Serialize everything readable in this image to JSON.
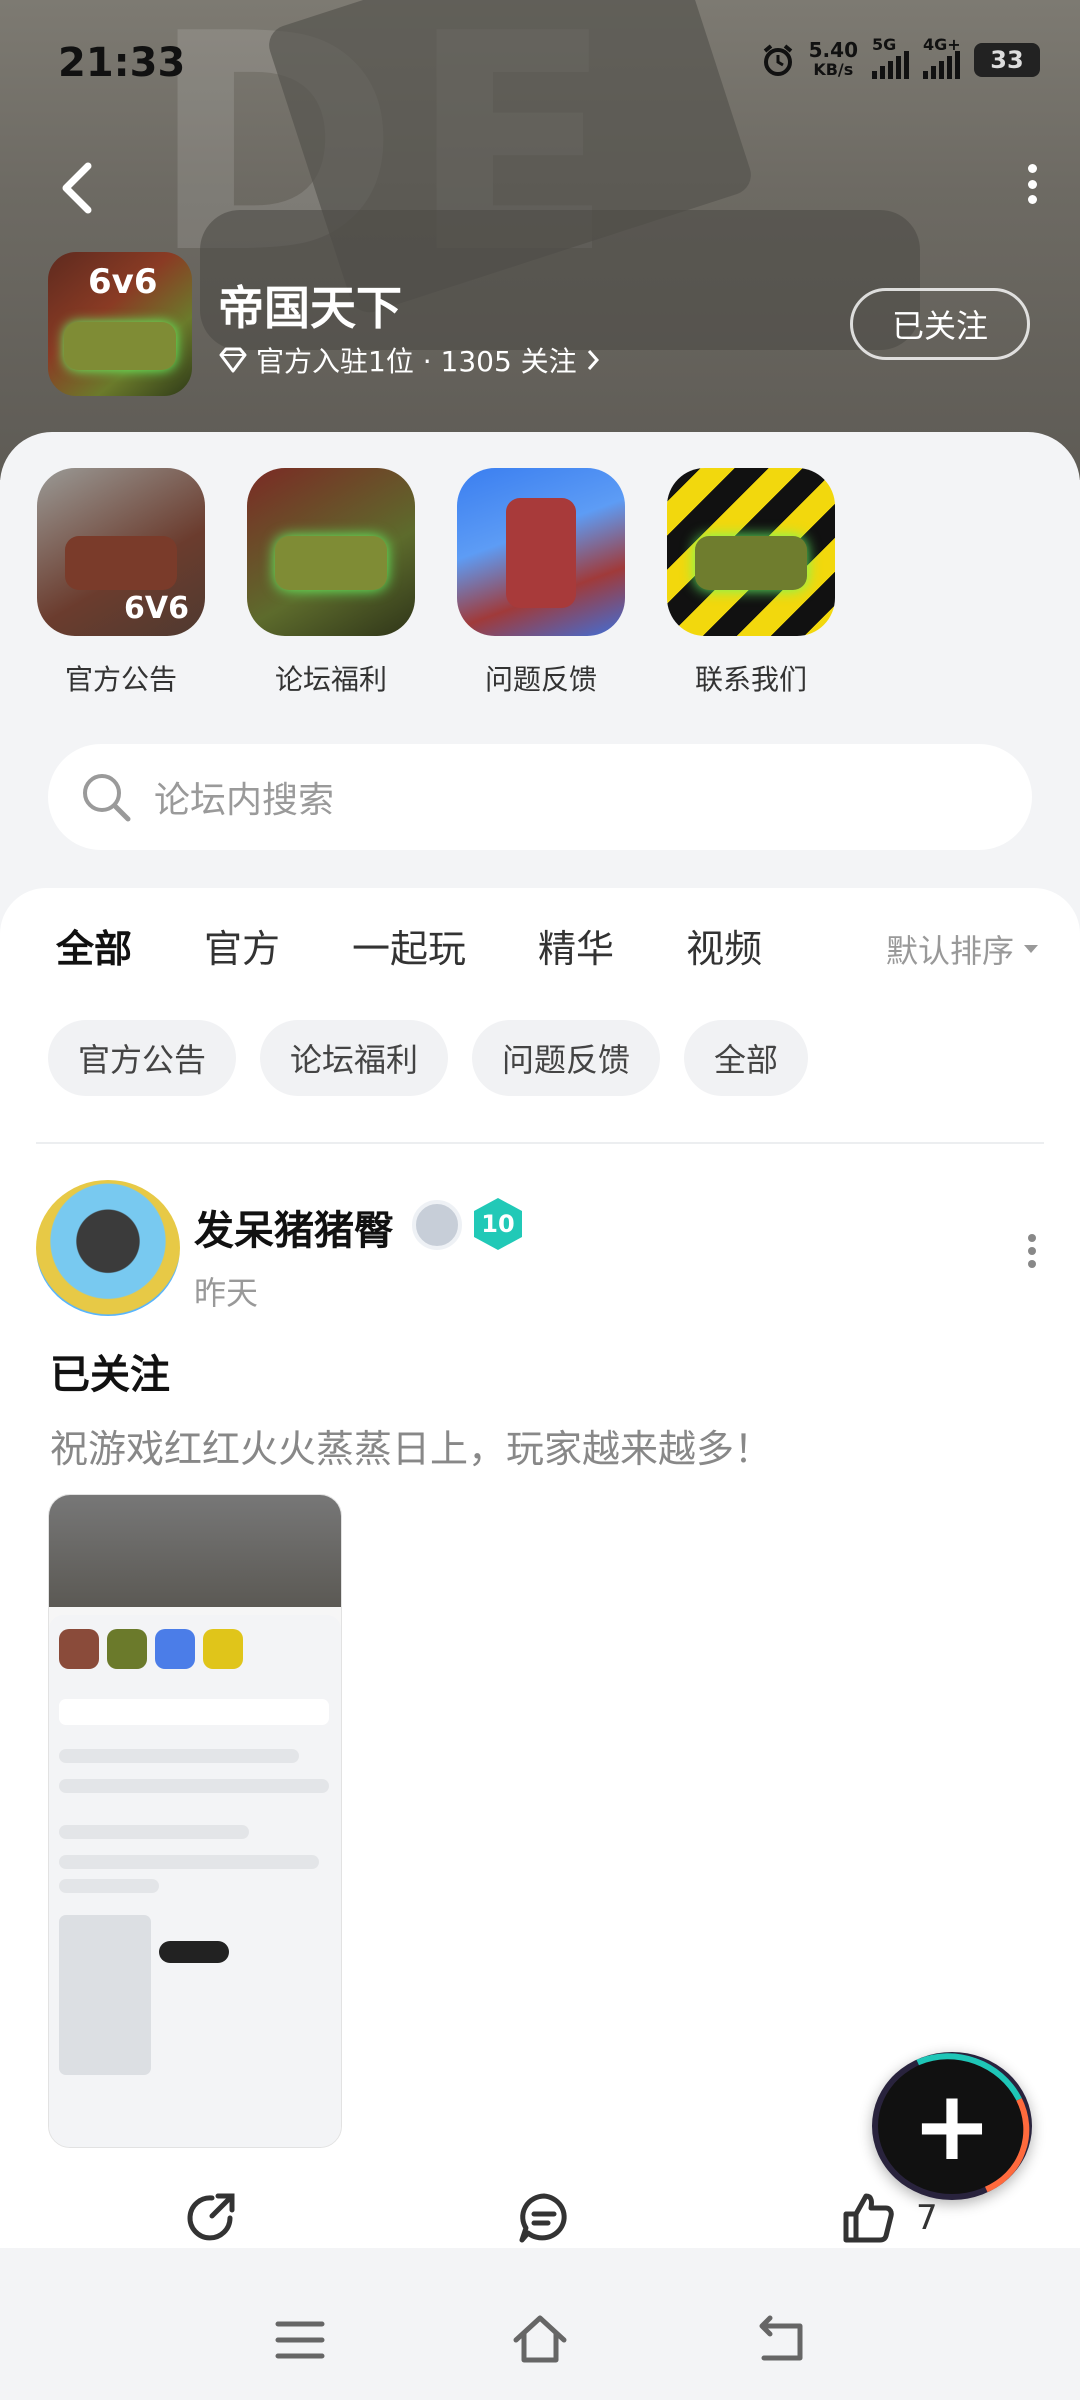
{
  "status_bar": {
    "time": "21:33",
    "speed_value": "5.40",
    "speed_unit": "KB/s",
    "net1": "5G",
    "net2": "4G+",
    "battery": "33"
  },
  "header": {
    "app_name": "帝国天下",
    "app_icon_tag": "6v6",
    "subtitle": "官方入驻1位 · 1305 关注",
    "follow_label": "已关注"
  },
  "shortcuts": [
    {
      "label": "官方公告",
      "img_tag": "6V6"
    },
    {
      "label": "论坛福利"
    },
    {
      "label": "问题反馈"
    },
    {
      "label": "联系我们"
    }
  ],
  "search": {
    "placeholder": "论坛内搜索"
  },
  "tabs": [
    "全部",
    "官方",
    "一起玩",
    "精华",
    "视频"
  ],
  "sort_label": "默认排序",
  "chips": [
    "官方公告",
    "论坛福利",
    "问题反馈",
    "全部"
  ],
  "post": {
    "author": "发呆猪猪臀",
    "level": "10",
    "time": "昨天",
    "title": "已关注",
    "body": "祝游戏红红火火蒸蒸日上，玩家越来越多！"
  },
  "actions": {
    "like_count": "7"
  },
  "colors": {
    "accent": "#19d5c6",
    "header_bg": "#6d6a63",
    "card_bg": "#f3f4f6"
  }
}
